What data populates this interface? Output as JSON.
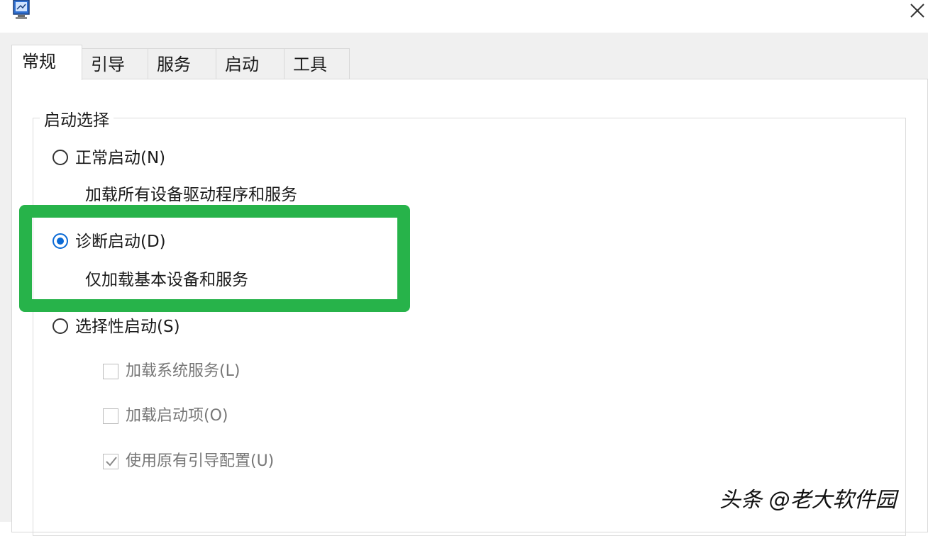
{
  "tabs": [
    {
      "label": "常规",
      "active": true
    },
    {
      "label": "引导",
      "active": false
    },
    {
      "label": "服务",
      "active": false
    },
    {
      "label": "启动",
      "active": false
    },
    {
      "label": "工具",
      "active": false
    }
  ],
  "group": {
    "title": "启动选择",
    "options": [
      {
        "label": "正常启动(N)",
        "description": "加载所有设备驱动程序和服务",
        "selected": false
      },
      {
        "label": "诊断启动(D)",
        "description": "仅加载基本设备和服务",
        "selected": true
      },
      {
        "label": "选择性启动(S)",
        "selected": false
      }
    ],
    "checkboxes": [
      {
        "label": "加载系统服务(L)",
        "checked": false,
        "enabled": false
      },
      {
        "label": "加载启动项(O)",
        "checked": false,
        "enabled": false
      },
      {
        "label": "使用原有引导配置(U)",
        "checked": true,
        "enabled": false
      }
    ]
  },
  "highlight_color": "#27b34a",
  "accent_color": "#0a6ad6",
  "watermark": "头条 @老大软件园",
  "icons": {
    "app": "system-config-icon",
    "close": "close-icon"
  }
}
